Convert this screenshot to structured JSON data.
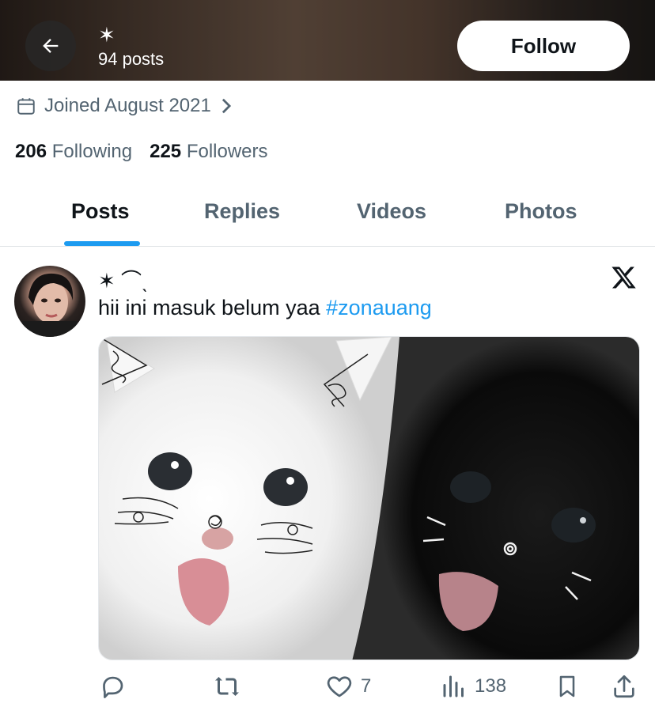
{
  "header": {
    "name": "✶",
    "posts_count": "94 posts",
    "follow_label": "Follow",
    "back_icon": "arrow-left-icon"
  },
  "profile": {
    "joined": "Joined August 2021",
    "following_count": "206",
    "following_label": "Following",
    "followers_count": "225",
    "followers_label": "Followers"
  },
  "tabs": [
    {
      "label": "Posts",
      "active": true
    },
    {
      "label": "Replies",
      "active": false
    },
    {
      "label": "Videos",
      "active": false
    },
    {
      "label": "Photos",
      "active": false
    }
  ],
  "post": {
    "author": "✶ ⌒ˎ",
    "text": "hii ini masuk belum yaa ",
    "hashtag": "#zonauang",
    "actions": {
      "reply_count": "",
      "repost_count": "",
      "like_count": "7",
      "views_count": "138"
    }
  },
  "colors": {
    "accent": "#1d9bf0",
    "text_primary": "#0f1419",
    "text_secondary": "#536471"
  }
}
